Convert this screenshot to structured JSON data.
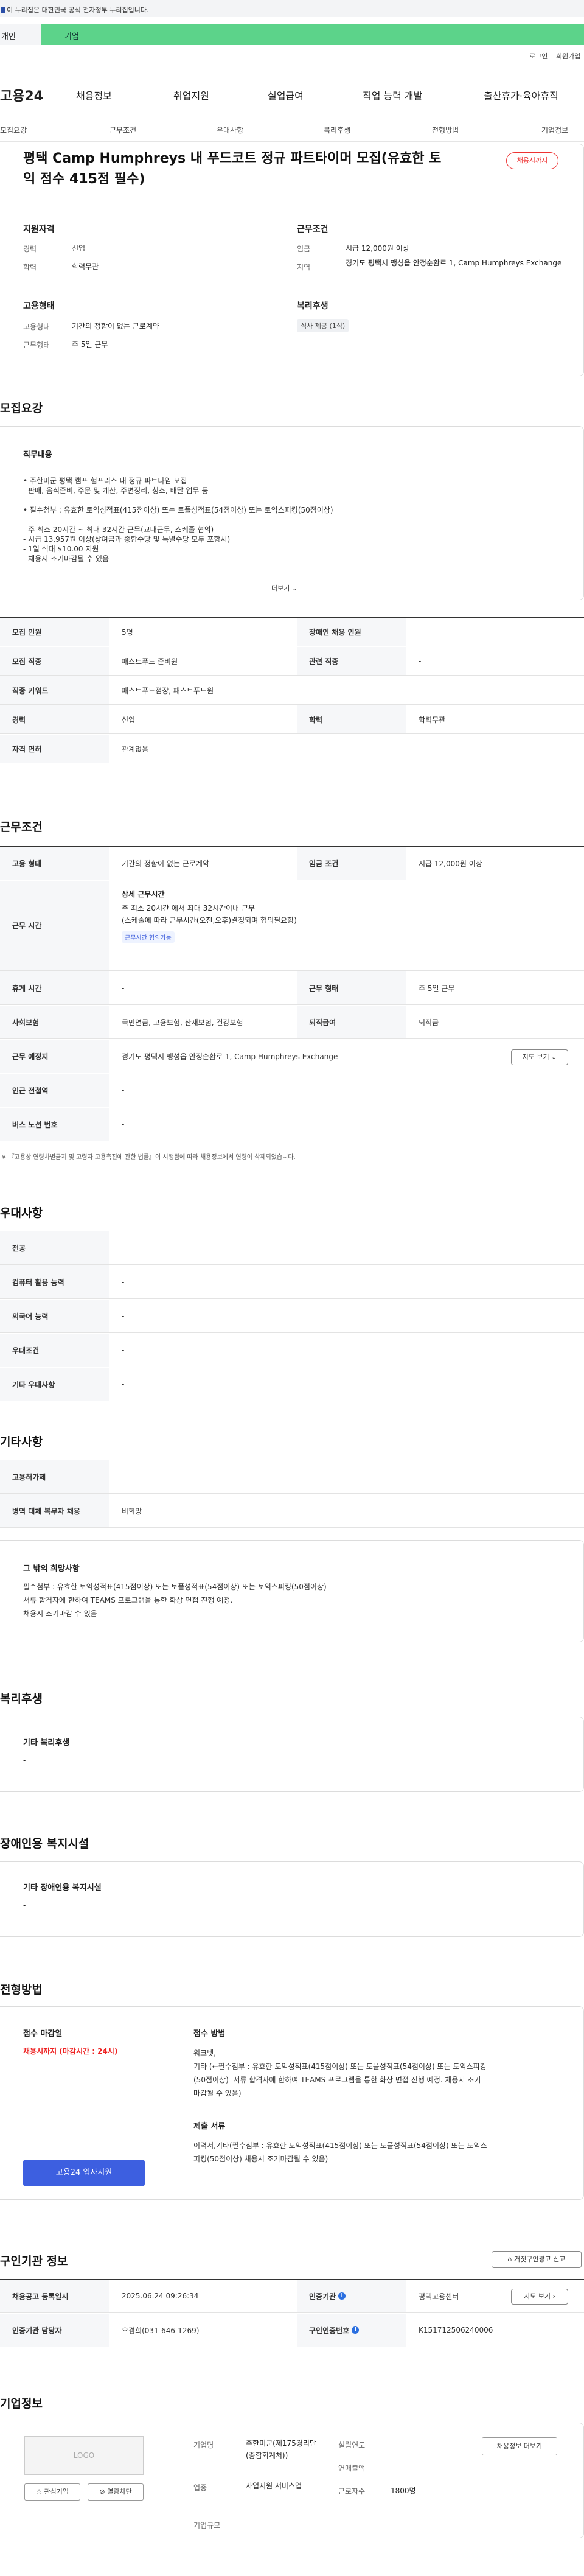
{
  "gov_bar": {
    "text": "이 누리집은 대한민국 공식 전자정부 누리집입니다."
  },
  "top_tabs": {
    "personal": "개인",
    "company": "기업"
  },
  "util": {
    "login": "로그인",
    "signup": "회원가입"
  },
  "brand": {
    "name": "고용24"
  },
  "gnb": [
    "채용정보",
    "취업지원",
    "실업급여",
    "직업 능력 개발",
    "출산휴가·육아휴직"
  ],
  "snb": [
    "모집요강",
    "근무조건",
    "우대사항",
    "복리후생",
    "전형방법",
    "기업정보"
  ],
  "job": {
    "title": "평택 Camp Humphreys 내 푸드코트 정규 파트타이머 모집(유효한 토익 점수 415점 필수)",
    "status": "채용시까지",
    "qual_head": "지원자격",
    "exp_k": "경력",
    "exp_v": "신입",
    "edu_k": "학력",
    "edu_v": "학력무관",
    "type_head": "고용형태",
    "type_k": "고용형태",
    "type_v": "기간의 정함이 없는 근로계약",
    "work_k": "근무형태",
    "work_v": "주 5일 근무",
    "cond_head": "근무조건",
    "wage_k": "임금",
    "wage_v": "시급 12,000원 이상",
    "loc_k": "지역",
    "loc_v": "경기도 평택시 팽성읍 안정순환로 1, Camp Humphreys Exchange",
    "welfare_head": "복리후생",
    "welfare_chip": "식사 제공 (1식)"
  },
  "recruit": {
    "heading": "모집요강",
    "duty_head": "직무내용",
    "duty_lines": [
      "• 주한미군 평택 캠프 험프리스 내 정규 파트타임 모집",
      "- 판매, 음식준비, 주문 및 계산, 주변정리, 청소, 배달 업무 등",
      "",
      "• 필수첨부 : 유효한 토익성적표(415점이상) 또는 토플성적표(54점이상) 또는 토익스피킹(50점이상)",
      "",
      "- 주 최소 20시간 ~ 최대 32시간 근무(교대근무, 스케줄 협의)",
      "- 시급 13,957원 이상(상여금과 종합수당 및 특별수당 모두 포함시)",
      "- 1일 식대 $10.00 지원",
      "- 채용시 조기마감될 수 있음"
    ],
    "more": "더보기",
    "rows": [
      {
        "k1": "모집 인원",
        "v1": "5명",
        "k2": "장애인 채용 인원",
        "v2": "-"
      },
      {
        "k1": "모집 직종",
        "v1": "패스트푸드 준비원",
        "k2": "관련 직종",
        "v2": "-"
      },
      {
        "k1": "직종 키워드",
        "v1": "패스트푸드점장, 패스트푸드원"
      },
      {
        "k1": "경력",
        "v1": "신입",
        "k2": "학력",
        "v2": "학력무관"
      },
      {
        "k1": "자격 면허",
        "v1": "관계없음"
      }
    ]
  },
  "conditions": {
    "heading": "근무조건",
    "r1": {
      "k1": "고용 형태",
      "v1": "기간의 정함이 없는 근로계약",
      "k2": "임금 조건",
      "v2": "시급 12,000원 이상"
    },
    "hours_k": "근무 시간",
    "hours_title": "상세 근무시간",
    "hours_l1": "주 최소 20시간 에서 최대 32시간이내 근무",
    "hours_l2": "(스케줄에 따라 근무시간(오전,오후)결정되며 협의필요함)",
    "hours_chip": "근무시간 협의가능",
    "r3": {
      "k1": "휴게 시간",
      "v1": "-",
      "k2": "근무 형태",
      "v2": "주 5일 근무"
    },
    "r4": {
      "k1": "사회보험",
      "v1": "국민연금, 고용보험, 산재보험, 건강보험",
      "k2": "퇴직급여",
      "v2": "퇴직금"
    },
    "place_k": "근무 예정지",
    "place_v": "경기도 평택시 팽성읍 안정순환로 1, Camp Humphreys Exchange",
    "map_btn": "지도 보기",
    "sub_k": "인근 전철역",
    "sub_v": "-",
    "bus_k": "버스 노선 번호",
    "bus_v": "-",
    "note": "※ 『고용상 연령차별금지 및 고령자 고용촉진에 관한 법률』이 시행됨에 따라 채용정보에서 연령이 삭제되었습니다."
  },
  "prefer": {
    "heading": "우대사항",
    "rows": [
      {
        "k": "전공",
        "v": "-"
      },
      {
        "k": "컴퓨터 활용 능력",
        "v": "-"
      },
      {
        "k": "외국어 능력",
        "v": "-"
      },
      {
        "k": "우대조건",
        "v": "-"
      },
      {
        "k": "기타 우대사항",
        "v": "-"
      }
    ]
  },
  "etc": {
    "heading": "기타사항",
    "rows": [
      {
        "k": "고용허가제",
        "v": "-"
      },
      {
        "k": "병역 대체 복무자 채용",
        "v": "비희망"
      }
    ],
    "box_head": "그 밖의 희망사항",
    "box_lines": [
      "필수첨부 : 유효한 토익성적표(415점이상) 또는 토플성적표(54점이상) 또는 토익스피킹(50점이상)",
      "서류 합격자에 한하여 TEAMS 프로그램을 통한 화상 면접 진행 예정.",
      "채용시 조기마감 수 있음"
    ]
  },
  "welfare": {
    "heading": "복리후생",
    "box_head": "기타 복리후생",
    "box_v": "-"
  },
  "disabled": {
    "heading": "장애인용 복지시설",
    "box_head": "기타 장애인용 복지시설",
    "box_v": "-"
  },
  "selection": {
    "heading": "전형방법",
    "deadline_head": "접수 마감일",
    "deadline_v": "채용시까지 (마감시간 : 24시)",
    "apply_btn": "고용24 입사지원",
    "method_head": "접수 방법",
    "method_lines": [
      "워크넷,",
      "기타 (←필수첨부 : 유효한 토익성적표(415점이상) 또는 토플성적표(54점이상) 또는 토익스피킹",
      "(50점이상)  서류 합격자에 한하여 TEAMS 프로그램을 통한 화상 면접 진행 예정. 채용시 조기",
      "마감될 수 있음)"
    ],
    "docs_head": "제출 서류",
    "docs_lines": [
      "이력서,기타(필수첨부 : 유효한 토익성적표(415점이상) 또는 토플성적표(54점이상) 또는 토익스",
      "피킹(50점이상) 채용시 조기마감될 수 있음)"
    ]
  },
  "agency": {
    "heading": "구인기관 정보",
    "report_btn": "거짓구인광고 신고",
    "r1": {
      "k1": "채용공고 등록일시",
      "v1": "2025.06.24 09:26:34",
      "k2": "인증기관",
      "v2": "평택고용센터"
    },
    "map_btn": "지도 보기",
    "r2": {
      "k1": "인증기관 담당자",
      "v1": "오경희(031-646-1269)",
      "k2": "구인인증번호",
      "v2": "K151712506240006"
    }
  },
  "company": {
    "heading": "기업정보",
    "logo_text": "LOGO",
    "fav_btn": "관심기업",
    "block_btn": "열람차단",
    "name_k": "기업명",
    "name_v": "주한미군(제175경리단(종합회계처))",
    "ind_k": "업종",
    "ind_v": "사업지원 서비스업",
    "size_k": "기업규모",
    "size_v": "-",
    "est_k": "설립연도",
    "est_v": "-",
    "sales_k": "연매출액",
    "sales_v": "-",
    "emp_k": "근로자수",
    "emp_v": "1800명",
    "jobs_btn": "채용정보 더보기"
  }
}
